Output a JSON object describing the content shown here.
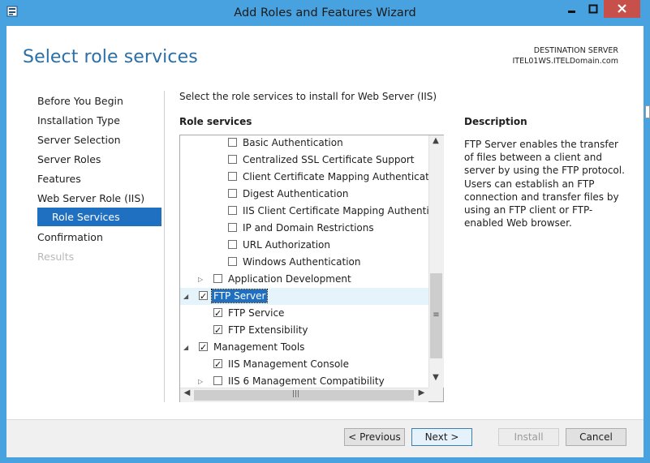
{
  "window": {
    "title": "Add Roles and Features Wizard",
    "icons": {
      "app": "server-manager-icon",
      "minimize": "minimize-icon",
      "maximize": "maximize-icon",
      "close": "close-icon"
    }
  },
  "header": {
    "page_title": "Select role services",
    "destination_label": "DESTINATION SERVER",
    "destination_server": "ITEL01WS.ITELDomain.com"
  },
  "nav": {
    "items": [
      {
        "label": "Before You Begin",
        "state": "normal"
      },
      {
        "label": "Installation Type",
        "state": "normal"
      },
      {
        "label": "Server Selection",
        "state": "normal"
      },
      {
        "label": "Server Roles",
        "state": "normal"
      },
      {
        "label": "Features",
        "state": "normal"
      },
      {
        "label": "Web Server Role (IIS)",
        "state": "normal"
      },
      {
        "label": "Role Services",
        "state": "selected"
      },
      {
        "label": "Confirmation",
        "state": "normal"
      },
      {
        "label": "Results",
        "state": "disabled"
      }
    ]
  },
  "main": {
    "instruction": "Select the role services to install for Web Server (IIS)",
    "role_services_heading": "Role services",
    "tree": [
      {
        "label": "Basic Authentication",
        "checked": false,
        "level": 3,
        "expander": "none"
      },
      {
        "label": "Centralized SSL Certificate Support",
        "checked": false,
        "level": 3,
        "expander": "none"
      },
      {
        "label": "Client Certificate Mapping Authentication",
        "checked": false,
        "level": 3,
        "expander": "none"
      },
      {
        "label": "Digest Authentication",
        "checked": false,
        "level": 3,
        "expander": "none"
      },
      {
        "label": "IIS Client Certificate Mapping Authentication",
        "checked": false,
        "level": 3,
        "expander": "none"
      },
      {
        "label": "IP and Domain Restrictions",
        "checked": false,
        "level": 3,
        "expander": "none"
      },
      {
        "label": "URL Authorization",
        "checked": false,
        "level": 3,
        "expander": "none"
      },
      {
        "label": "Windows Authentication",
        "checked": false,
        "level": 3,
        "expander": "none"
      },
      {
        "label": "Application Development",
        "checked": false,
        "level": 2,
        "expander": "collapsed"
      },
      {
        "label": "FTP Server",
        "checked": true,
        "level": 1,
        "expander": "expanded",
        "selected": true
      },
      {
        "label": "FTP Service",
        "checked": true,
        "level": 2,
        "expander": "none"
      },
      {
        "label": "FTP Extensibility",
        "checked": true,
        "level": 2,
        "expander": "none"
      },
      {
        "label": "Management Tools",
        "checked": true,
        "level": 1,
        "expander": "expanded"
      },
      {
        "label": "IIS Management Console",
        "checked": true,
        "level": 2,
        "expander": "none"
      },
      {
        "label": "IIS 6 Management Compatibility",
        "checked": false,
        "level": 2,
        "expander": "collapsed"
      }
    ],
    "scroll_position": 0.74
  },
  "description": {
    "heading": "Description",
    "text": "FTP Server enables the transfer of files between a client and server by using the FTP protocol. Users can establish an FTP connection and transfer files by using an FTP client or FTP-enabled Web browser."
  },
  "footer": {
    "previous_label": "< Previous",
    "next_label": "Next >",
    "install_label": "Install",
    "cancel_label": "Cancel"
  },
  "colors": {
    "title_bar": "#49a2e0",
    "close_button": "#c7504a",
    "accent": "#1f70c1",
    "page_title": "#2b6fa8"
  }
}
